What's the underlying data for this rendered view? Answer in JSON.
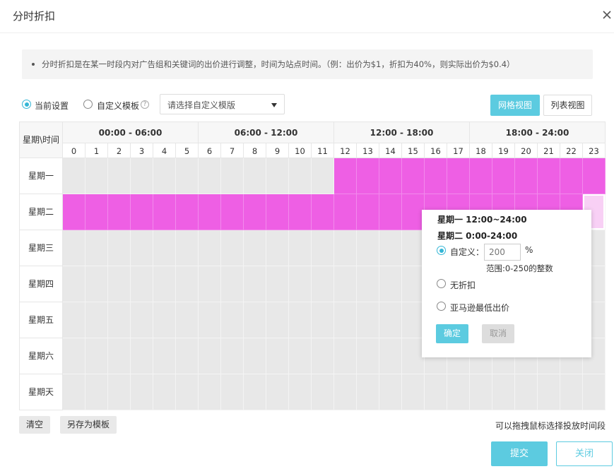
{
  "dialog": {
    "title": "分时折扣",
    "notice": "分时折扣是在某一时段内对广告组和关键词的出价进行调整，时间为站点时间。（例：出价为$1，折扣为40%，则实际出价为$0.4）"
  },
  "toolbar": {
    "radio_current": "当前设置",
    "radio_template": "自定义模板",
    "template_select_placeholder": "请选择自定义模版",
    "grid_view_label": "网格视图",
    "list_view_label": "列表视图",
    "selected_mode": "current"
  },
  "schedule": {
    "corner_label": "星期\\时间",
    "ranges": [
      "00:00 - 06:00",
      "06:00 - 12:00",
      "12:00 - 18:00",
      "18:00 - 24:00"
    ],
    "hours": [
      "0",
      "1",
      "2",
      "3",
      "4",
      "5",
      "6",
      "7",
      "8",
      "9",
      "10",
      "11",
      "12",
      "13",
      "14",
      "15",
      "16",
      "17",
      "18",
      "19",
      "20",
      "21",
      "22",
      "23"
    ],
    "days": [
      "星期一",
      "星期二",
      "星期三",
      "星期四",
      "星期五",
      "星期六",
      "星期天"
    ],
    "selected": [
      [
        12,
        13,
        14,
        15,
        16,
        17,
        18,
        19,
        20,
        21,
        22,
        23
      ],
      [
        0,
        1,
        2,
        3,
        4,
        5,
        6,
        7,
        8,
        9,
        10,
        11,
        12,
        13,
        14,
        15,
        16,
        17,
        18,
        19,
        20,
        21,
        22
      ],
      [],
      [],
      [],
      [],
      []
    ],
    "pending": [
      [],
      [
        23
      ],
      [],
      [],
      [],
      [],
      []
    ],
    "colors": {
      "selected": "#ee5fe4",
      "empty": "#e8e8e8",
      "pending": "#f8d0f5"
    }
  },
  "popup": {
    "range_line_1": "星期一 12:00~24:00",
    "range_line_2": "星期二 0:00-24:00",
    "option_custom": "自定义：",
    "custom_value": "200",
    "percent_sign": "%",
    "range_hint": "范围:0-250的整数",
    "option_no_discount": "无折扣",
    "option_amazon_lowest": "亚马逊最低出价",
    "confirm_label": "确定",
    "cancel_label": "取消",
    "selected_option": "custom"
  },
  "bottom": {
    "clear_label": "清空",
    "save_template_label": "另存为模板",
    "drag_hint": "可以拖拽鼠标选择投放时间段"
  },
  "footer": {
    "submit_label": "提交",
    "close_label": "关闭"
  },
  "theme": {
    "accent": "#5ccbe0",
    "radio": "#35b6d6"
  }
}
